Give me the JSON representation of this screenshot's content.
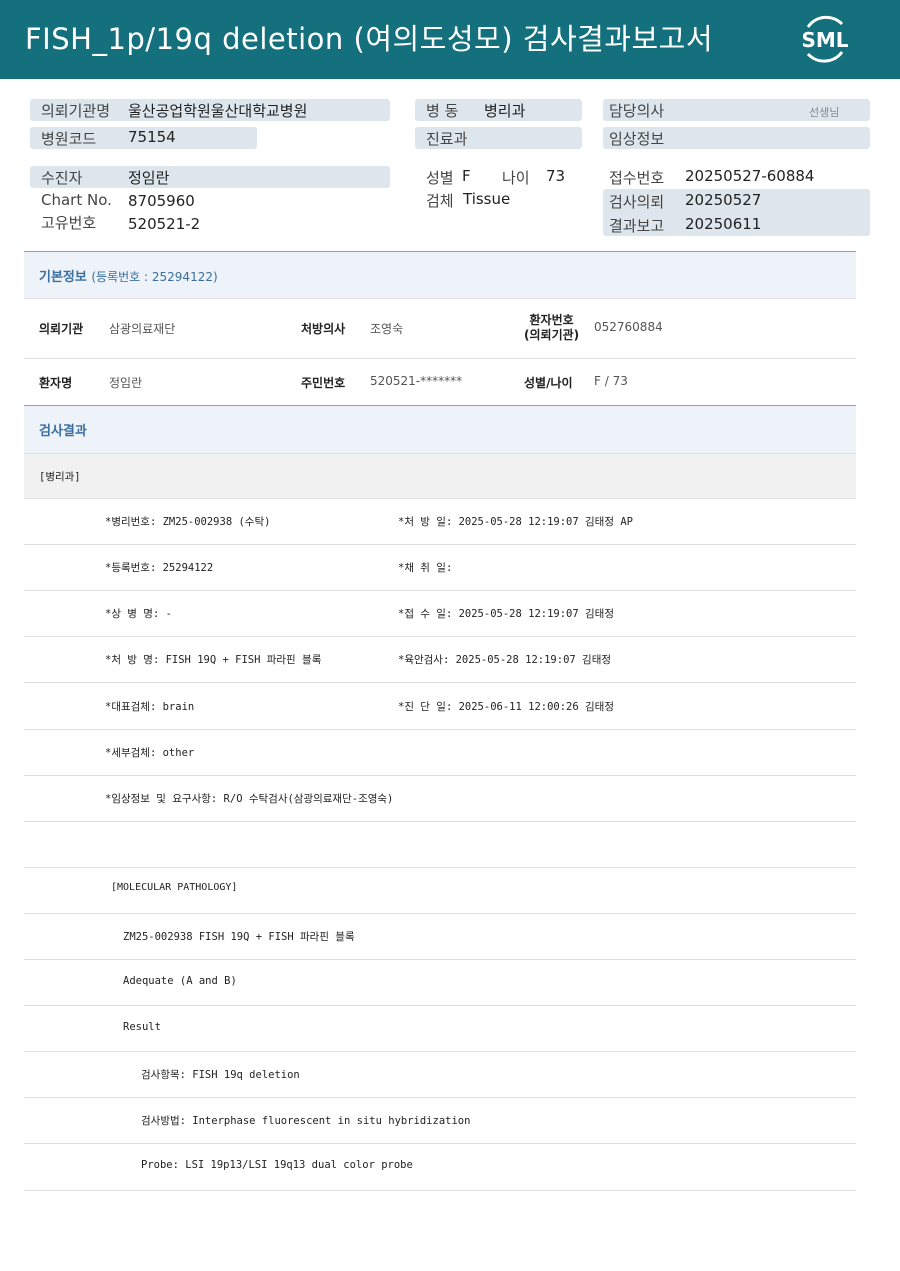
{
  "header": {
    "title": "FISH_1p/19q  deletion (여의도성모) 검사결과보고서",
    "logo_text": "SML"
  },
  "top_info": {
    "requesting_institution_label": "의뢰기관명",
    "requesting_institution_value": "울산공업학원울산대학교병원",
    "hospital_code_label": "병원코드",
    "hospital_code_value": "75154",
    "ward_label": "병  동",
    "ward_value": "병리과",
    "department_label": "진료과",
    "doctor_label": "담당의사",
    "doctor_suffix": "선생님",
    "clinical_info_label": "임상정보",
    "patient_label": "수진자",
    "patient_value": "정임란",
    "chart_label": "Chart No.",
    "chart_value": "8705960",
    "unique_no_label": "고유번호",
    "unique_no_value": "520521-2",
    "sex_label": "성별",
    "sex_value": "F",
    "age_label": "나이",
    "age_value": "73",
    "specimen_label": "검체",
    "specimen_value": "Tissue",
    "receipt_no_label": "접수번호",
    "receipt_no_value": "20250527-60884",
    "request_date_label": "검사의뢰",
    "request_date_value": "20250527",
    "report_date_label": "결과보고",
    "report_date_value": "20250611"
  },
  "basic_info": {
    "section_title": "기본정보",
    "registration": "(등록번호 : 25294122)",
    "institution_label": "의뢰기관",
    "institution_value": "삼광의료재단",
    "prescriber_label": "처방의사",
    "prescriber_value": "조영숙",
    "patient_no_label_line1": "환자번호",
    "patient_no_label_line2": "(의뢰기관)",
    "patient_no_value": "052760884",
    "name_label": "환자명",
    "name_value": "정임란",
    "resident_no_label": "주민번호",
    "resident_no_value": "520521-*******",
    "sex_age_label": "성별/나이",
    "sex_age_value": "F / 73"
  },
  "results": {
    "section_title": "검사결과",
    "department_band": "[병리과]",
    "rows": [
      {
        "left": "*병리번호: ZM25-002938 (수탁)",
        "right": "*처 방 일: 2025-05-28 12:19:07  김태정 AP"
      },
      {
        "left": "*등록번호: 25294122",
        "right": "*채 취 일:"
      },
      {
        "left": "*상 병 명: -",
        "right": "*접 수 일: 2025-05-28 12:19:07  김태정"
      },
      {
        "left": "*처 방 명: FISH 19Q + FISH 파라핀 블록",
        "right": "*육안검사: 2025-05-28 12:19:07  김태정"
      },
      {
        "left": "*대표검체: brain",
        "right": "*진 단 일: 2025-06-11 12:00:26  김태정"
      },
      {
        "left": "*세부검체: other",
        "right": ""
      },
      {
        "left": "*임상정보 및 요구사항: R/O 수탁검사(삼광의료재단-조영숙)",
        "right": ""
      }
    ],
    "molecular": {
      "heading": "[MOLECULAR PATHOLOGY]",
      "line1": "ZM25-002938     FISH 19Q + FISH 파라핀 블록",
      "line2": "Adequate (A and B)",
      "line3": "Result",
      "line4": "검사항목: FISH 19q deletion",
      "line5": "검사방법: Interphase fluorescent in situ hybridization",
      "line6": "Probe: LSI 19p13/LSI 19q13 dual color probe"
    }
  }
}
